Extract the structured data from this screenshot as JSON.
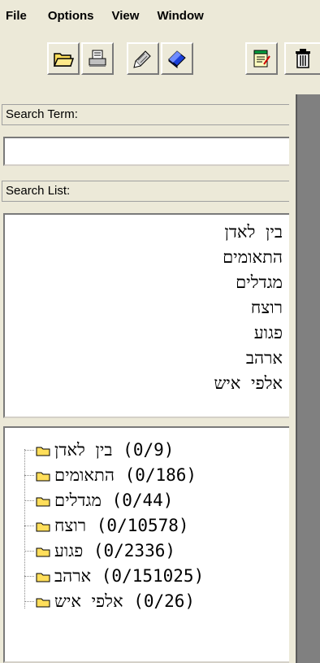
{
  "menu": {
    "items": [
      "File",
      "Options",
      "View",
      "Window"
    ]
  },
  "toolbar": {
    "buttons": [
      {
        "icon": "open-folder-icon"
      },
      {
        "icon": "print-icon"
      },
      {
        "icon": "note-pen-icon"
      },
      {
        "icon": "eraser-icon"
      },
      {
        "icon": "notepad-icon"
      },
      {
        "icon": "trash-icon"
      }
    ]
  },
  "search": {
    "term_label": "Search Term:",
    "term_value": "",
    "list_label": "Search List:"
  },
  "search_list": [
    "בין לאדן",
    "התאומים",
    "מגדלים",
    "רוצח",
    "פגוע",
    "ארהב",
    "אלפי איש"
  ],
  "tree": [
    {
      "label": "בין לאדן",
      "count": "(0/9)"
    },
    {
      "label": "התאומים",
      "count": "(0/186)"
    },
    {
      "label": "מגדלים",
      "count": "(0/44)"
    },
    {
      "label": "רוצח",
      "count": "(0/10578)"
    },
    {
      "label": "פגוע",
      "count": "(0/2336)"
    },
    {
      "label": "ארהב",
      "count": "(0/151025)"
    },
    {
      "label": "אלפי איש",
      "count": "(0/26)"
    }
  ],
  "colors": {
    "window_bg": "#ece9d8",
    "folder_yellow": "#ffde5a",
    "panel_gray": "#808080"
  }
}
